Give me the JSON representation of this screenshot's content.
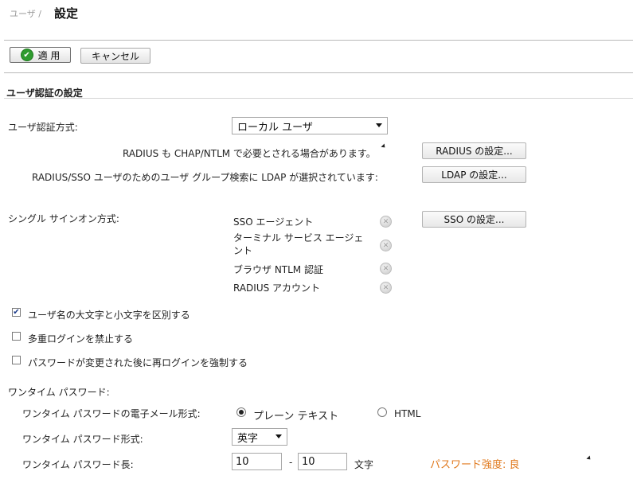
{
  "breadcrumb": {
    "parent": "ユーザ /",
    "title": "設定"
  },
  "toolbar": {
    "apply_label": "適 用",
    "cancel_label": "キャンセル"
  },
  "section": {
    "title": "ユーザ認証の設定"
  },
  "auth": {
    "method_label": "ユーザ認証方式:",
    "method_value": "ローカル ユーザ",
    "radius_note": "RADIUS も CHAP/NTLM で必要とされる場合があります。",
    "radius_button": "RADIUS の設定...",
    "ldap_note": "RADIUS/SSO ユーザのためのユーザ グループ検索に LDAP が選択されています:",
    "ldap_button": "LDAP の設定..."
  },
  "sso": {
    "label": "シングル サインオン方式:",
    "items": [
      {
        "label": "SSO エージェント"
      },
      {
        "label": "ターミナル サービス エージェ\nント"
      },
      {
        "label": "ブラウザ NTLM 認証"
      },
      {
        "label": "RADIUS アカウント"
      }
    ],
    "button": "SSO の設定..."
  },
  "checkboxes": [
    {
      "label": "ユーザ名の大文字と小文字を区別する",
      "checked": true
    },
    {
      "label": "多重ログインを禁止する",
      "checked": false
    },
    {
      "label": "パスワードが変更された後に再ログインを強制する",
      "checked": false
    }
  ],
  "otp": {
    "label": "ワンタイム パスワード:",
    "email_format_label": "ワンタイム パスワードの電子メール形式:",
    "email_format_options": [
      {
        "label": "プレーン テキスト",
        "selected": true
      },
      {
        "label": "HTML",
        "selected": false
      }
    ],
    "format_label": "ワンタイム パスワード形式:",
    "format_value": "英字",
    "length_label": "ワンタイム パスワード長:",
    "length_min": "10",
    "length_sep": "-",
    "length_max": "10",
    "length_unit": "文字",
    "strength": "パスワード強度: 良",
    "strength_color": "#e07a1f"
  }
}
